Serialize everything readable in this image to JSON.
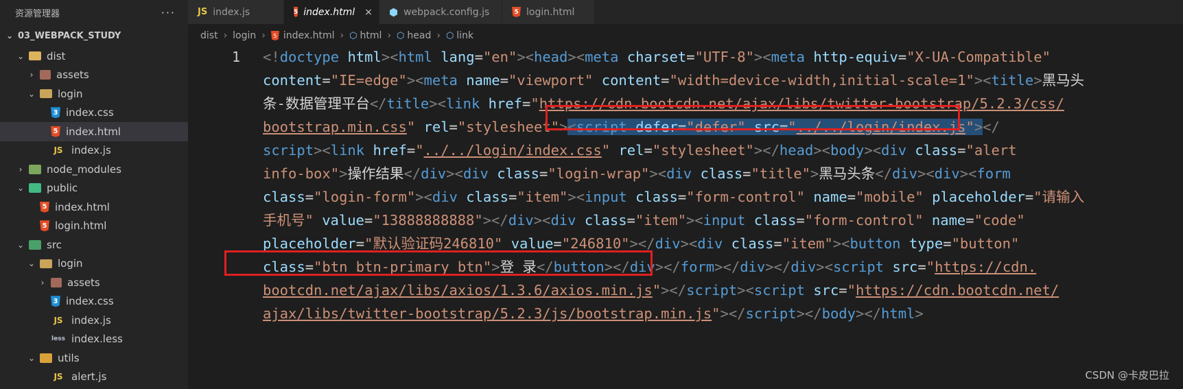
{
  "sidebar": {
    "title": "资源管理器",
    "more": "···",
    "root": "03_WEBPACK_STUDY",
    "items": [
      {
        "label": "dist",
        "icon": "dist",
        "chev": "open",
        "indent": 1
      },
      {
        "label": "assets",
        "icon": "assets",
        "chev": "closed",
        "indent": 2
      },
      {
        "label": "login",
        "icon": "login",
        "chev": "open",
        "indent": 2
      },
      {
        "label": "index.css",
        "icon": "css",
        "chev": "none",
        "indent": 3
      },
      {
        "label": "index.html",
        "icon": "html",
        "chev": "none",
        "indent": 3,
        "selected": true
      },
      {
        "label": "index.js",
        "icon": "js",
        "chev": "none",
        "indent": 3
      },
      {
        "label": "node_modules",
        "icon": "nm",
        "chev": "closed",
        "indent": 1
      },
      {
        "label": "public",
        "icon": "pub",
        "chev": "open",
        "indent": 1
      },
      {
        "label": "index.html",
        "icon": "html",
        "chev": "none",
        "indent": 2
      },
      {
        "label": "login.html",
        "icon": "html",
        "chev": "none",
        "indent": 2
      },
      {
        "label": "src",
        "icon": "src",
        "chev": "open",
        "indent": 1
      },
      {
        "label": "login",
        "icon": "login",
        "chev": "open",
        "indent": 2
      },
      {
        "label": "assets",
        "icon": "assets",
        "chev": "closed",
        "indent": 3
      },
      {
        "label": "index.css",
        "icon": "css",
        "chev": "none",
        "indent": 3
      },
      {
        "label": "index.js",
        "icon": "js",
        "chev": "none",
        "indent": 3
      },
      {
        "label": "index.less",
        "icon": "less",
        "chev": "none",
        "indent": 3
      },
      {
        "label": "utils",
        "icon": "utils",
        "chev": "open",
        "indent": 2
      },
      {
        "label": "alert.js",
        "icon": "js",
        "chev": "none",
        "indent": 3
      }
    ]
  },
  "tabs": [
    {
      "label": "index.js",
      "icon": "js",
      "active": false
    },
    {
      "label": "index.html",
      "icon": "html",
      "active": true,
      "close": "×"
    },
    {
      "label": "webpack.config.js",
      "icon": "wp",
      "active": false
    },
    {
      "label": "login.html",
      "icon": "html",
      "active": false
    }
  ],
  "breadcrumb": [
    "dist",
    "login",
    "index.html",
    "html",
    "head",
    "link"
  ],
  "editor": {
    "line_number": "1",
    "lines": [
      [
        [
          "p",
          "<!"
        ],
        [
          "t",
          "doctype"
        ],
        [
          "x",
          " "
        ],
        [
          "a",
          "html"
        ],
        [
          "p",
          "><"
        ],
        [
          "t",
          "html"
        ],
        [
          "x",
          " "
        ],
        [
          "a",
          "lang"
        ],
        [
          "x",
          "="
        ],
        [
          "s",
          "\"en\""
        ],
        [
          "p",
          "><"
        ],
        [
          "t",
          "head"
        ],
        [
          "p",
          "><"
        ],
        [
          "t",
          "meta"
        ],
        [
          "x",
          " "
        ],
        [
          "a",
          "charset"
        ],
        [
          "x",
          "="
        ],
        [
          "s",
          "\"UTF-8\""
        ],
        [
          "p",
          "><"
        ],
        [
          "t",
          "meta"
        ],
        [
          "x",
          " "
        ],
        [
          "a",
          "http-equiv"
        ],
        [
          "x",
          "="
        ],
        [
          "s",
          "\"X-UA-Compatible\""
        ]
      ],
      [
        [
          "a",
          "content"
        ],
        [
          "x",
          "="
        ],
        [
          "s",
          "\"IE=edge\""
        ],
        [
          "p",
          "><"
        ],
        [
          "t",
          "meta"
        ],
        [
          "x",
          " "
        ],
        [
          "a",
          "name"
        ],
        [
          "x",
          "="
        ],
        [
          "s",
          "\"viewport\""
        ],
        [
          "x",
          " "
        ],
        [
          "a",
          "content"
        ],
        [
          "x",
          "="
        ],
        [
          "s",
          "\"width=device-width,initial-scale=1\""
        ],
        [
          "p",
          "><"
        ],
        [
          "t",
          "title"
        ],
        [
          "p",
          ">"
        ],
        [
          "x",
          "黑马头"
        ]
      ],
      [
        [
          "x",
          "条-数据管理平台"
        ],
        [
          "p",
          "</"
        ],
        [
          "t",
          "title"
        ],
        [
          "p",
          "><"
        ],
        [
          "t",
          "link"
        ],
        [
          "x",
          " "
        ],
        [
          "a",
          "href"
        ],
        [
          "x",
          "="
        ],
        [
          "s",
          "\""
        ],
        [
          "u",
          "https://cdn.bootcdn.net/ajax/libs/twitter-bootstrap/5.2.3/css/"
        ]
      ],
      [
        [
          "u",
          "bootstrap.min.css"
        ],
        [
          "s",
          "\""
        ],
        [
          "x",
          " "
        ],
        [
          "a",
          "rel"
        ],
        [
          "x",
          "="
        ],
        [
          "s",
          "\"stylesheet\""
        ],
        [
          "p",
          ">"
        ],
        [
          "selp",
          "<"
        ],
        [
          "selt",
          "script"
        ],
        [
          "selx",
          " "
        ],
        [
          "sela",
          "defer"
        ],
        [
          "selx",
          "="
        ],
        [
          "sels",
          "\"defer\""
        ],
        [
          "selx",
          " "
        ],
        [
          "sela",
          "src"
        ],
        [
          "selx",
          "="
        ],
        [
          "sels",
          "\""
        ],
        [
          "selu",
          "../../login/index.js"
        ],
        [
          "sels",
          "\""
        ],
        [
          "selp",
          ">"
        ],
        [
          "p",
          "</"
        ]
      ],
      [
        [
          "t",
          "script"
        ],
        [
          "p",
          "><"
        ],
        [
          "t",
          "link"
        ],
        [
          "x",
          " "
        ],
        [
          "a",
          "href"
        ],
        [
          "x",
          "="
        ],
        [
          "s",
          "\""
        ],
        [
          "u",
          "../../login/index.css"
        ],
        [
          "s",
          "\""
        ],
        [
          "x",
          " "
        ],
        [
          "a",
          "rel"
        ],
        [
          "x",
          "="
        ],
        [
          "s",
          "\"stylesheet\""
        ],
        [
          "p",
          "></"
        ],
        [
          "t",
          "head"
        ],
        [
          "p",
          "><"
        ],
        [
          "t",
          "body"
        ],
        [
          "p",
          "><"
        ],
        [
          "t",
          "div"
        ],
        [
          "x",
          " "
        ],
        [
          "a",
          "class"
        ],
        [
          "x",
          "="
        ],
        [
          "s",
          "\"alert"
        ]
      ],
      [
        [
          "s",
          "info-box\""
        ],
        [
          "p",
          ">"
        ],
        [
          "x",
          "操作结果"
        ],
        [
          "p",
          "</"
        ],
        [
          "t",
          "div"
        ],
        [
          "p",
          "><"
        ],
        [
          "t",
          "div"
        ],
        [
          "x",
          " "
        ],
        [
          "a",
          "class"
        ],
        [
          "x",
          "="
        ],
        [
          "s",
          "\"login-wrap\""
        ],
        [
          "p",
          "><"
        ],
        [
          "t",
          "div"
        ],
        [
          "x",
          " "
        ],
        [
          "a",
          "class"
        ],
        [
          "x",
          "="
        ],
        [
          "s",
          "\"title\""
        ],
        [
          "p",
          ">"
        ],
        [
          "x",
          "黑马头条"
        ],
        [
          "p",
          "</"
        ],
        [
          "t",
          "div"
        ],
        [
          "p",
          "><"
        ],
        [
          "t",
          "div"
        ],
        [
          "p",
          "><"
        ],
        [
          "t",
          "form"
        ]
      ],
      [
        [
          "a",
          "class"
        ],
        [
          "x",
          "="
        ],
        [
          "s",
          "\"login-form\""
        ],
        [
          "p",
          "><"
        ],
        [
          "t",
          "div"
        ],
        [
          "x",
          " "
        ],
        [
          "a",
          "class"
        ],
        [
          "x",
          "="
        ],
        [
          "s",
          "\"item\""
        ],
        [
          "p",
          "><"
        ],
        [
          "t",
          "input"
        ],
        [
          "x",
          " "
        ],
        [
          "a",
          "class"
        ],
        [
          "x",
          "="
        ],
        [
          "s",
          "\"form-control\""
        ],
        [
          "x",
          " "
        ],
        [
          "a",
          "name"
        ],
        [
          "x",
          "="
        ],
        [
          "s",
          "\"mobile\""
        ],
        [
          "x",
          " "
        ],
        [
          "a",
          "placeholder"
        ],
        [
          "x",
          "="
        ],
        [
          "s",
          "\"请输入"
        ]
      ],
      [
        [
          "s",
          "手机号\""
        ],
        [
          "x",
          " "
        ],
        [
          "a",
          "value"
        ],
        [
          "x",
          "="
        ],
        [
          "s",
          "\"13888888888\""
        ],
        [
          "p",
          "></"
        ],
        [
          "t",
          "div"
        ],
        [
          "p",
          "><"
        ],
        [
          "t",
          "div"
        ],
        [
          "x",
          " "
        ],
        [
          "a",
          "class"
        ],
        [
          "x",
          "="
        ],
        [
          "s",
          "\"item\""
        ],
        [
          "p",
          "><"
        ],
        [
          "t",
          "input"
        ],
        [
          "x",
          " "
        ],
        [
          "a",
          "class"
        ],
        [
          "x",
          "="
        ],
        [
          "s",
          "\"form-control\""
        ],
        [
          "x",
          " "
        ],
        [
          "a",
          "name"
        ],
        [
          "x",
          "="
        ],
        [
          "s",
          "\"code\""
        ]
      ],
      [
        [
          "a",
          "placeholder"
        ],
        [
          "x",
          "="
        ],
        [
          "s",
          "\"默认验证码246810\""
        ],
        [
          "x",
          " "
        ],
        [
          "a",
          "value"
        ],
        [
          "x",
          "="
        ],
        [
          "s",
          "\"246810\""
        ],
        [
          "p",
          "></"
        ],
        [
          "t",
          "div"
        ],
        [
          "p",
          "><"
        ],
        [
          "t",
          "div"
        ],
        [
          "x",
          " "
        ],
        [
          "a",
          "class"
        ],
        [
          "x",
          "="
        ],
        [
          "s",
          "\"item\""
        ],
        [
          "p",
          "><"
        ],
        [
          "t",
          "button"
        ],
        [
          "x",
          " "
        ],
        [
          "a",
          "type"
        ],
        [
          "x",
          "="
        ],
        [
          "s",
          "\"button\""
        ]
      ],
      [
        [
          "a",
          "class"
        ],
        [
          "x",
          "="
        ],
        [
          "s",
          "\"btn btn-primary btn\""
        ],
        [
          "p",
          ">"
        ],
        [
          "x",
          "登 录"
        ],
        [
          "p",
          "</"
        ],
        [
          "t",
          "button"
        ],
        [
          "p",
          "></"
        ],
        [
          "t",
          "div"
        ],
        [
          "p",
          "></"
        ],
        [
          "t",
          "form"
        ],
        [
          "p",
          "></"
        ],
        [
          "t",
          "div"
        ],
        [
          "p",
          "></"
        ],
        [
          "t",
          "div"
        ],
        [
          "p",
          "><"
        ],
        [
          "t",
          "script"
        ],
        [
          "x",
          " "
        ],
        [
          "a",
          "src"
        ],
        [
          "x",
          "="
        ],
        [
          "s",
          "\""
        ],
        [
          "u",
          "https://cdn."
        ]
      ],
      [
        [
          "u",
          "bootcdn.net/ajax/libs/axios/1.3.6/axios.min.js"
        ],
        [
          "s",
          "\""
        ],
        [
          "p",
          ">"
        ],
        [
          "p",
          "</"
        ],
        [
          "t",
          "script"
        ],
        [
          "p",
          "><"
        ],
        [
          "t",
          "script"
        ],
        [
          "x",
          " "
        ],
        [
          "a",
          "src"
        ],
        [
          "x",
          "="
        ],
        [
          "s",
          "\""
        ],
        [
          "u",
          "https://cdn.bootcdn.net/"
        ]
      ],
      [
        [
          "u",
          "ajax/libs/twitter-bootstrap/5.2.3/js/bootstrap.min.js"
        ],
        [
          "s",
          "\""
        ],
        [
          "p",
          "></"
        ],
        [
          "t",
          "script"
        ],
        [
          "p",
          "></"
        ],
        [
          "t",
          "body"
        ],
        [
          "p",
          "></"
        ],
        [
          "t",
          "html"
        ],
        [
          "p",
          ">"
        ]
      ]
    ]
  },
  "watermark": "CSDN @卡皮巴拉",
  "colors": {
    "highlight_box": "#e02020",
    "selection": "#264f78"
  }
}
